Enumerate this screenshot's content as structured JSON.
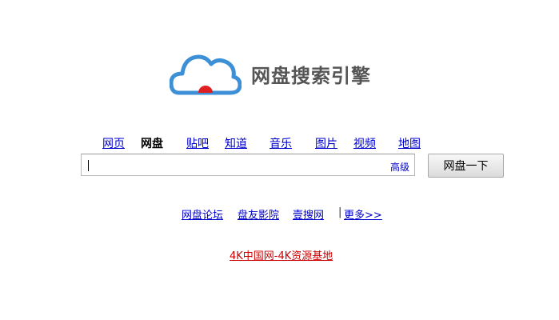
{
  "logo": {
    "text": "网盘搜索引擎",
    "cloud_color": "#3d8fd6",
    "dot_color": "#e02020"
  },
  "nav": {
    "items": [
      {
        "label": "网页",
        "active": false
      },
      {
        "label": "网盘",
        "active": true
      },
      {
        "label": "贴吧",
        "active": false
      },
      {
        "label": "知道",
        "active": false
      },
      {
        "label": "音乐",
        "active": false
      },
      {
        "label": "图片",
        "active": false
      },
      {
        "label": "视频",
        "active": false
      },
      {
        "label": "地图",
        "active": false
      }
    ]
  },
  "search": {
    "value": "",
    "advanced_label": "高级",
    "button_label": "网盘一下"
  },
  "links": {
    "items": [
      "网盘论坛",
      "盘友影院",
      "壹搜网"
    ],
    "separator": "|",
    "more_label": "更多>>"
  },
  "partner": {
    "label": "4K中国网-4K资源基地",
    "color": "#cc0000"
  }
}
